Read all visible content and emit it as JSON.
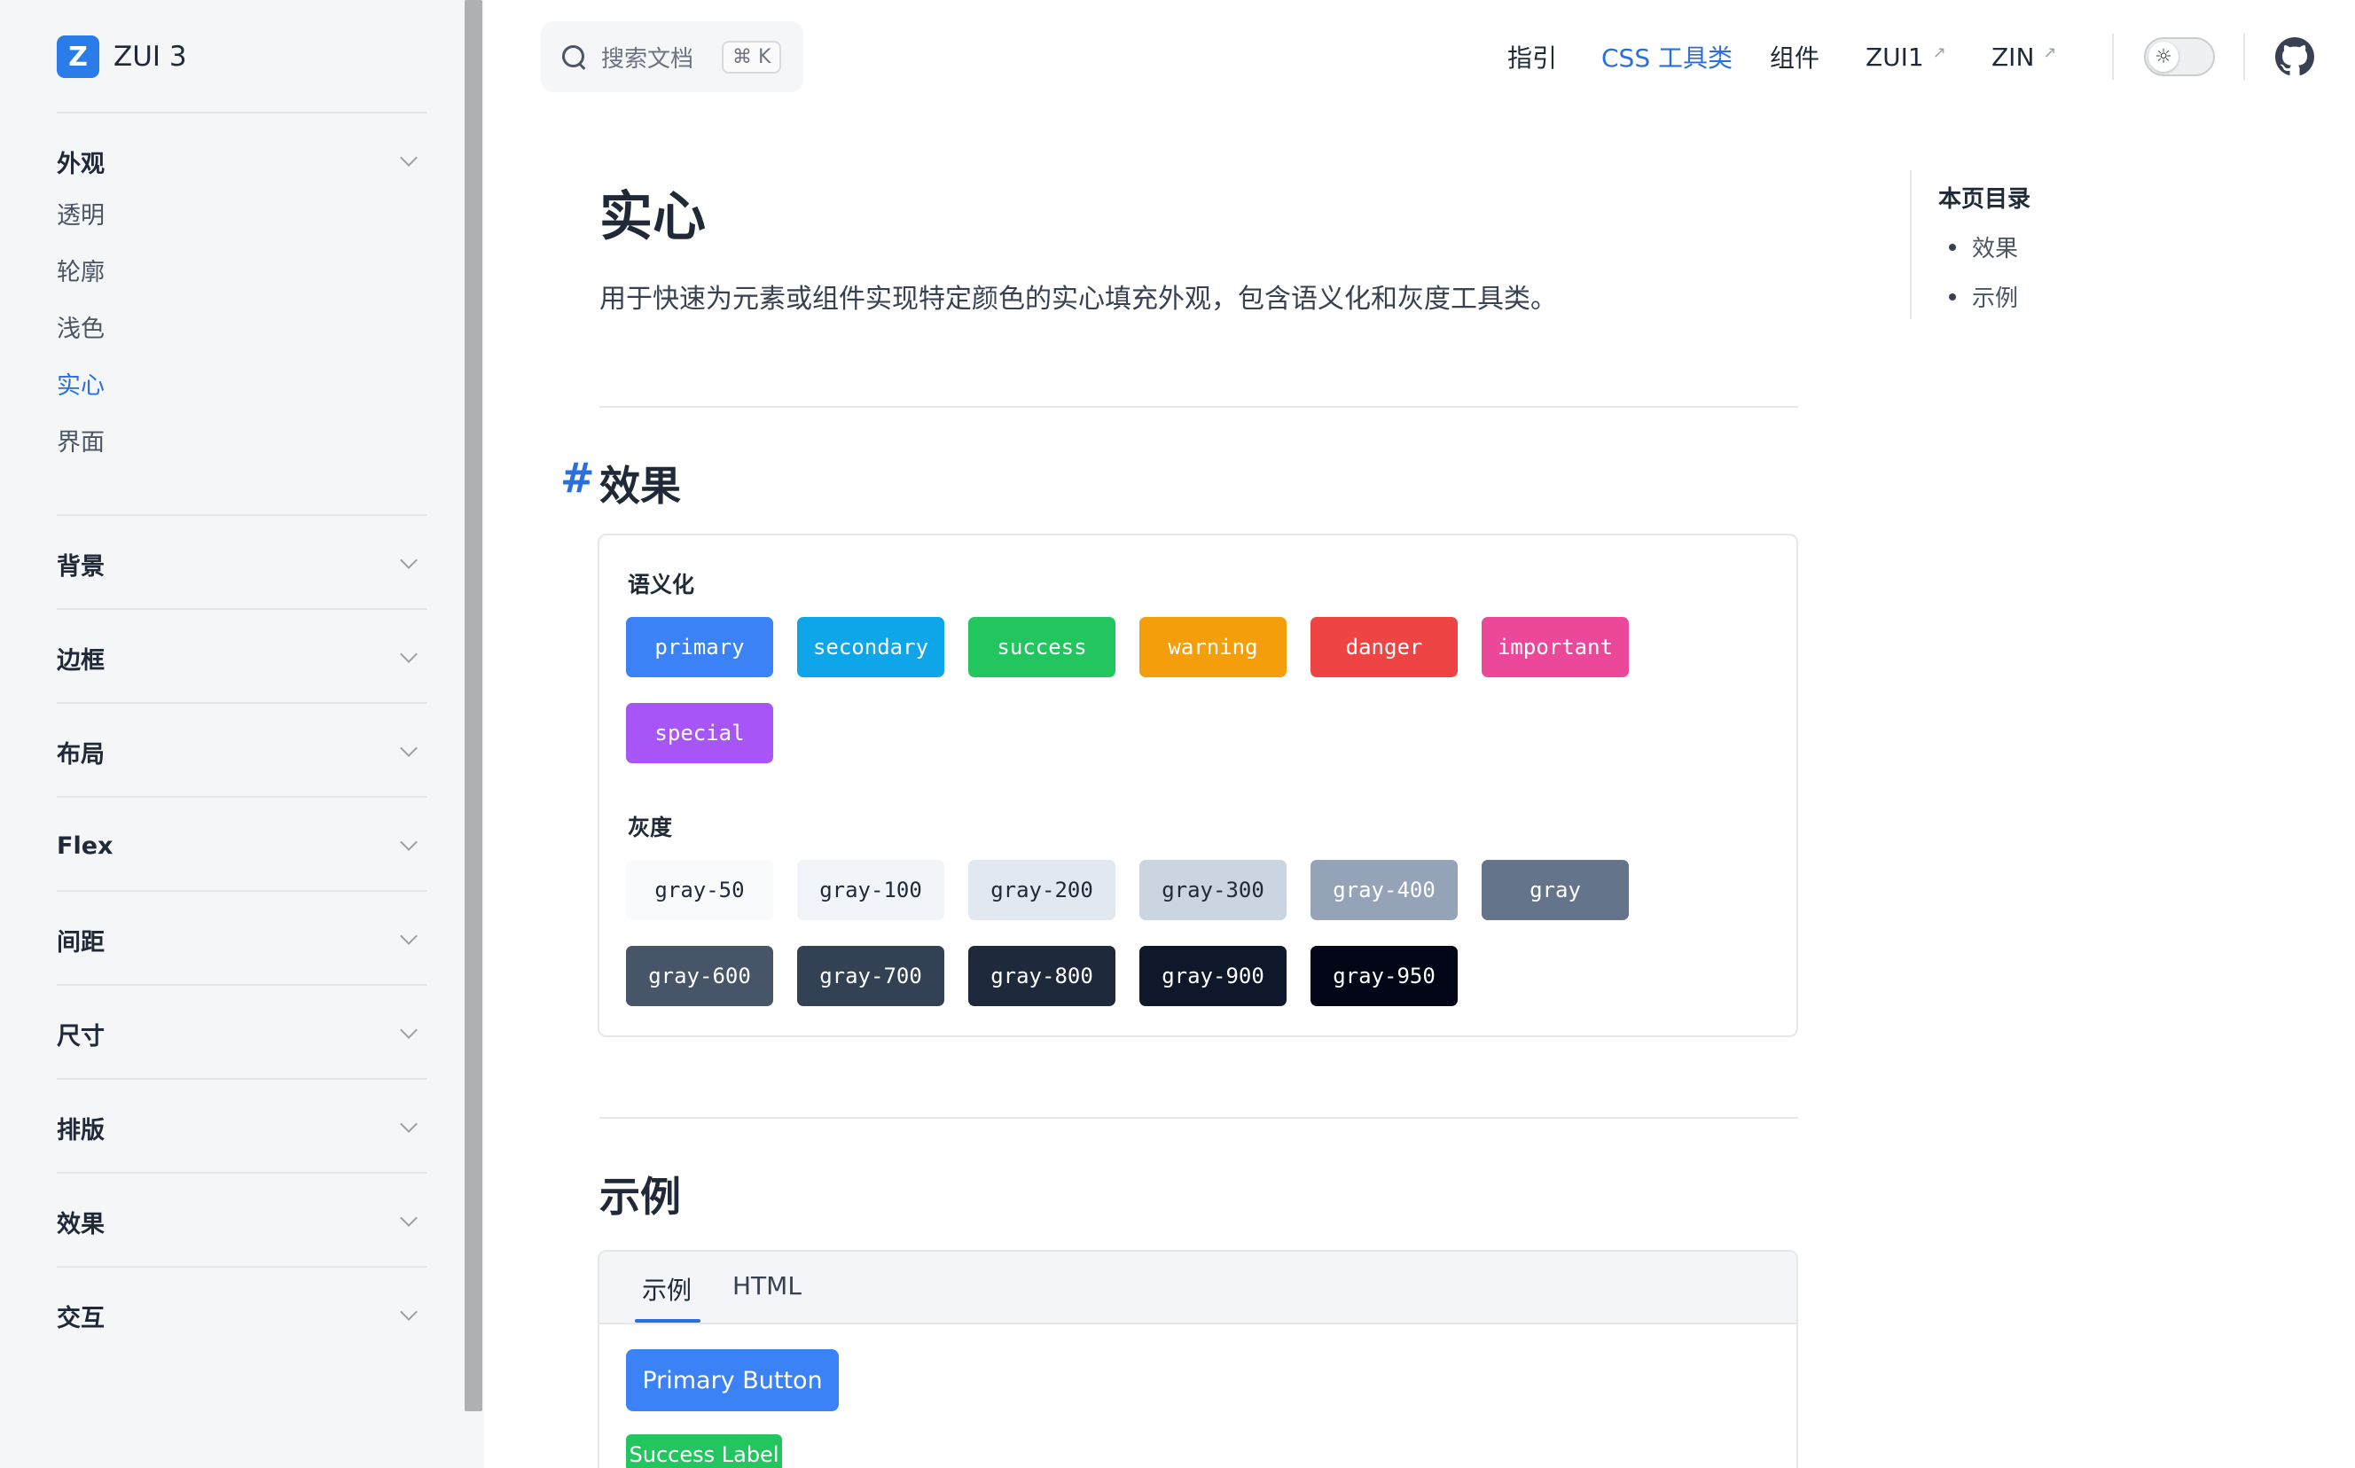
{
  "sidebar": {
    "brand": "ZUI 3",
    "brand_logo_letter": "Z",
    "groups": [
      {
        "label": "外观",
        "items": [
          "透明",
          "轮廓",
          "浅色",
          "实心",
          "界面"
        ],
        "active_item": "实心"
      },
      {
        "label": "背景"
      },
      {
        "label": "边框"
      },
      {
        "label": "布局"
      },
      {
        "label": "Flex"
      },
      {
        "label": "间距"
      },
      {
        "label": "尺寸"
      },
      {
        "label": "排版"
      },
      {
        "label": "效果"
      },
      {
        "label": "交互"
      }
    ]
  },
  "topbar": {
    "search": {
      "placeholder": "搜索文档",
      "shortcut": "⌘ K"
    },
    "nav": [
      {
        "label": "指引"
      },
      {
        "label": "CSS 工具类",
        "active": true
      },
      {
        "label": "组件"
      },
      {
        "label": "ZUI1",
        "external": true
      },
      {
        "label": "ZIN",
        "external": true
      }
    ],
    "external_mark": "↗"
  },
  "main": {
    "title": "实心",
    "description": "用于快速为元素或组件实现特定颜色的实心填充外观，包含语义化和灰度工具类。",
    "section_effect": {
      "anchor": "#",
      "heading": "效果",
      "semantic_label": "语义化",
      "semantic": [
        {
          "label": "primary",
          "bg": "#3b82f6",
          "fg": "#ffffff"
        },
        {
          "label": "secondary",
          "bg": "#0ea5e9",
          "fg": "#ffffff"
        },
        {
          "label": "success",
          "bg": "#22c55e",
          "fg": "#ffffff"
        },
        {
          "label": "warning",
          "bg": "#f59e0b",
          "fg": "#ffffff"
        },
        {
          "label": "danger",
          "bg": "#ef4444",
          "fg": "#ffffff"
        },
        {
          "label": "important",
          "bg": "#ec4899",
          "fg": "#ffffff"
        },
        {
          "label": "special",
          "bg": "#a855f7",
          "fg": "#ffffff"
        }
      ],
      "gray_label": "灰度",
      "gray": [
        {
          "label": "gray-50",
          "bg": "#f8fafc",
          "fg": "#1f2937"
        },
        {
          "label": "gray-100",
          "bg": "#f1f5f9",
          "fg": "#1f2937"
        },
        {
          "label": "gray-200",
          "bg": "#e2e8f0",
          "fg": "#1f2937"
        },
        {
          "label": "gray-300",
          "bg": "#cbd5e1",
          "fg": "#1f2937"
        },
        {
          "label": "gray-400",
          "bg": "#94a3b8",
          "fg": "#ffffff"
        },
        {
          "label": "gray",
          "bg": "#64748b",
          "fg": "#ffffff"
        },
        {
          "label": "gray-600",
          "bg": "#475569",
          "fg": "#ffffff"
        },
        {
          "label": "gray-700",
          "bg": "#334155",
          "fg": "#ffffff"
        },
        {
          "label": "gray-800",
          "bg": "#1e293b",
          "fg": "#ffffff"
        },
        {
          "label": "gray-900",
          "bg": "#0f172a",
          "fg": "#ffffff"
        },
        {
          "label": "gray-950",
          "bg": "#020617",
          "fg": "#ffffff"
        }
      ]
    },
    "section_example": {
      "heading": "示例",
      "tabs": [
        "示例",
        "HTML"
      ],
      "active_tab": "示例",
      "primary_button": "Primary Button",
      "success_label": "Success Label"
    }
  },
  "toc": {
    "title": "本页目录",
    "items": [
      "效果",
      "示例"
    ]
  },
  "colors": {
    "accent": "#2a6fdb",
    "brand": "#2a7de9"
  },
  "icons": {
    "search": "search-icon",
    "theme": "sun-icon",
    "github": "github-icon",
    "chevron": "chevron-down-icon"
  }
}
